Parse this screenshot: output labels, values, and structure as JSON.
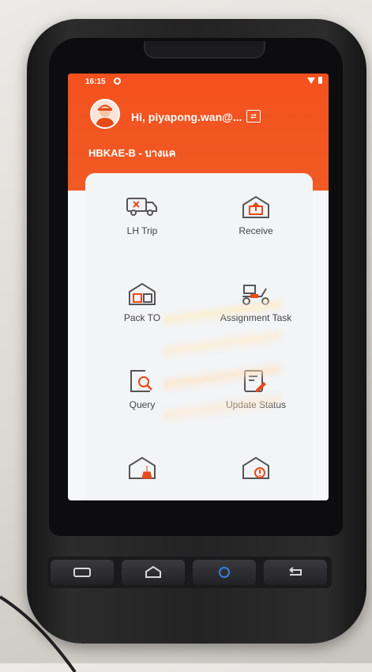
{
  "status_bar": {
    "time": "16:15"
  },
  "header": {
    "greeting": "Hi, piyapong.wan@...",
    "branch": "HBKAE-B - บางแค",
    "switch_icon": "swap-icon"
  },
  "menu": [
    {
      "label": "LH Trip",
      "icon": "truck-icon"
    },
    {
      "label": "Receive",
      "icon": "receive-box-icon"
    },
    {
      "label": "Pack TO",
      "icon": "pack-box-icon"
    },
    {
      "label": "Assignment Task",
      "icon": "scooter-icon"
    },
    {
      "label": "Query",
      "icon": "search-icon"
    },
    {
      "label": "Update Status",
      "icon": "edit-document-icon"
    }
  ],
  "colors": {
    "header": "#f4511e",
    "icon_accent": "#e64a19",
    "icon_stroke": "#555555"
  }
}
